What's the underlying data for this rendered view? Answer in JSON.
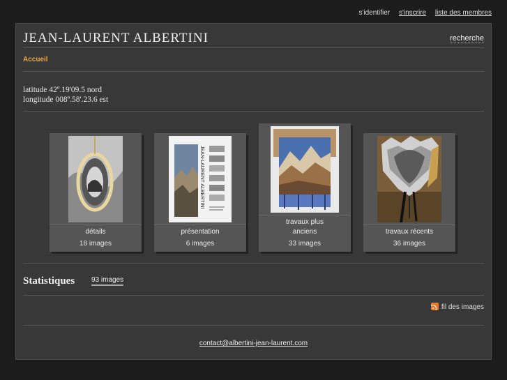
{
  "topnav": {
    "login": "s'identifier",
    "register": "s'inscrire",
    "members": "liste des membres"
  },
  "header": {
    "title": "JEAN-LAURENT ALBERTINI",
    "search": "recherche"
  },
  "breadcrumb": "Accueil",
  "location": {
    "latitude": "latitude 42º.19'09.5 nord",
    "longitude": "longitude 008º.58'.23.6 est"
  },
  "albums": [
    {
      "name_line1": "détails",
      "name_line2": "",
      "count": "18 images"
    },
    {
      "name_line1": "présentation",
      "name_line2": "",
      "count": "6 images"
    },
    {
      "name_line1": "travaux plus",
      "name_line2": "anciens",
      "count": "33 images"
    },
    {
      "name_line1": "travaux récents",
      "name_line2": "",
      "count": "36 images"
    }
  ],
  "stats": {
    "title": "Statistiques",
    "count": "93 images"
  },
  "rss": {
    "label": "fil des images",
    "icon": "rss-icon"
  },
  "footer": {
    "contact": "contact@albertini-jean-laurent.com"
  },
  "colors": {
    "background": "#1c1c1c",
    "panel": "#383838",
    "accent": "#f0a64a"
  }
}
